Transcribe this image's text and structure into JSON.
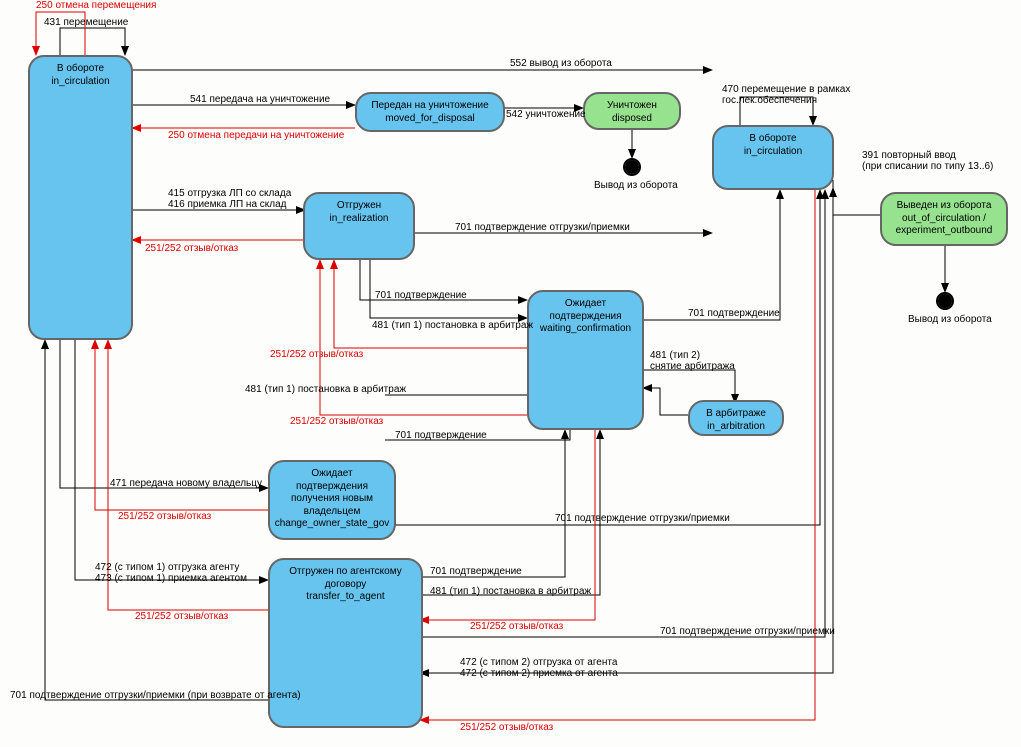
{
  "nodes": {
    "in_circ_left": "В обороте\nin_circulation",
    "moved_for_disposal": "Передан на уничтожение\nmoved_for_disposal",
    "disposed": "Уничтожен\ndisposed",
    "in_circ_right": "В обороте\nin_circulation",
    "out_of_circ": "Выведен из оборота\nout_of_circulation /\nexperiment_outbound",
    "in_realization": "Отгружен\nin_realization",
    "waiting_confirmation": "Ожидает подтверждения\nwaiting_confirmation",
    "in_arbitration": "В арбитраже\nin_arbitration",
    "change_owner": "Ожидает\nподтверждения\nполучения новым\nвладельцем\nchange_owner_state_gov",
    "transfer_to_agent": "Отгружен по агентскому\nдоговору\ntransfer_to_agent",
    "exit1": "Вывод из оборота",
    "exit2": "Вывод из оборота"
  },
  "edges": {
    "e431": "431 перемещение",
    "e250a": "250 отмена перемещения",
    "e552": "552 вывод из оборота",
    "e541": "541 передача на уничтожение",
    "e250b": "250 отмена передачи на уничтожение",
    "e542": "542 уничтожение",
    "e470": "470 перемещение в рамках\nгос.лек.обеспечения",
    "e391": "391 повторный ввод\n(при списании по типу 13..6)",
    "e415": "415 отгрузка ЛП со склада\n416 приемка ЛП на склад",
    "e251a": "251/252 отзыв/отказ",
    "e701a": "701 подтверждение отгрузки/приемки",
    "e701b": "701 подтверждение",
    "e481a": "481 (тип 1) постановка в арбитраж",
    "e251b": "251/252 отзыв/отказ",
    "e701c": "701 подтверждение",
    "e481b": "481 (тип 2)\nснятие арбитража",
    "e481c": "481 (тип 1) постановка в арбитраж",
    "e251c": "251/252 отзыв/отказ",
    "e701d": "701 подтверждение",
    "e471": "471 передача новому владельцу",
    "e251d": "251/252 отзыв/отказ",
    "e701e": "701 подтверждение отгрузки/приемки",
    "e472a": "472 (с типом 1) отгрузка агенту\n473 (с типом 1) приемка агентом",
    "e251e": "251/252 отзыв/отказ",
    "e701f": "701 подтверждение",
    "e481d": "481 (тип 1) постановка в арбитраж",
    "e251f": "251/252 отзыв/отказ",
    "e701g": "701 подтверждение отгрузки/приемки",
    "e472b": "472 (с типом 2) отгрузка от агента\n472 (с типом 2) приемка от агента",
    "e251g": "251/252 отзыв/отказ",
    "e701h": "701 подтверждение отгрузки/приемки  (при возврате от агента)"
  }
}
